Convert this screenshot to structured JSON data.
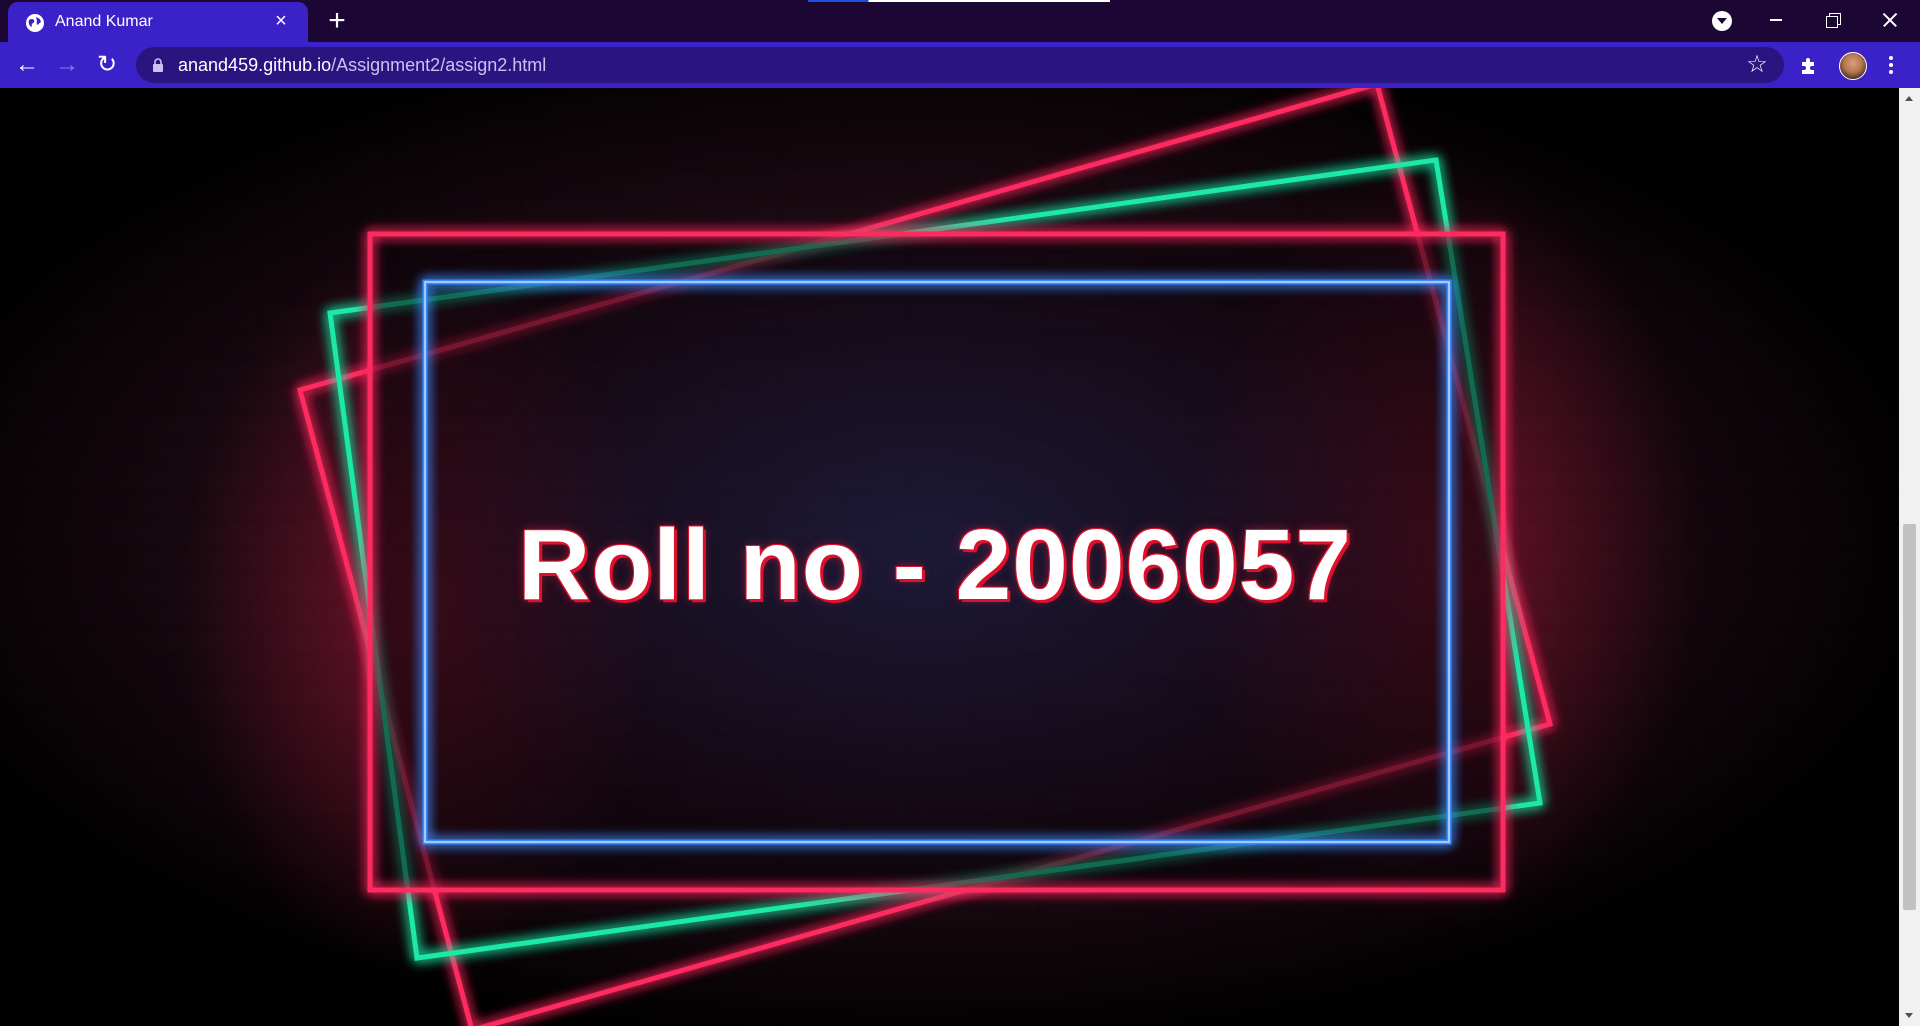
{
  "browser": {
    "tab": {
      "title": "Anand Kumar",
      "favicon": "globe-icon"
    },
    "new_tab_symbol": "+",
    "close_symbol": "×",
    "url": {
      "host": "anand459.github.io",
      "path": "/Assignment2/assign2.html"
    },
    "nav": {
      "back": "←",
      "forward": "→",
      "reload": "↻"
    },
    "bookmark_symbol": "☆"
  },
  "page": {
    "heading": "Roll no - 2006057"
  },
  "colors": {
    "tabstrip": "#1c0633",
    "toolbar": "#3a22c8",
    "neon_pink": "#ff2a5f",
    "neon_green": "#1de9a6",
    "neon_blue": "#3b8cff"
  }
}
